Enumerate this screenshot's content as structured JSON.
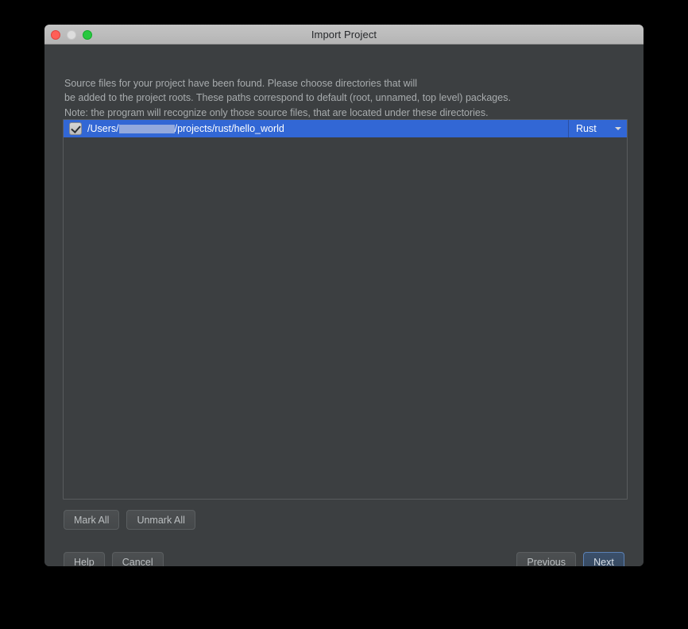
{
  "window": {
    "title": "Import Project",
    "traffic_lights": [
      {
        "name": "close",
        "color": "#ff5f57"
      },
      {
        "name": "minimize",
        "color": "#dddddd"
      },
      {
        "name": "zoom",
        "color": "#28c840"
      }
    ]
  },
  "description": {
    "line1": "Source files for your project have been found. Please choose directories that will",
    "line2": "be added to the project roots. These paths correspond to default (root, unnamed, top level) packages.",
    "line3": "Note: the program will recognize only those source files, that are located under these directories."
  },
  "list": {
    "rows": [
      {
        "checked": true,
        "path_prefix": "/Users/",
        "path_redacted": true,
        "path_suffix": "/projects/rust/hello_world",
        "type": "Rust",
        "selected": true
      }
    ]
  },
  "mark_buttons": {
    "mark_all": "Mark All",
    "unmark_all": "Unmark All"
  },
  "footer": {
    "help": "Help",
    "cancel": "Cancel",
    "previous": "Previous",
    "next": "Next"
  },
  "colors": {
    "dialog_background": "#3c3f41",
    "titlebar": "#bcbcbc",
    "selection_blue": "#3267d5",
    "redaction_block": "#93a9dd",
    "default_button_border": "#5b81b5",
    "text_secondary": "#a8acae"
  }
}
